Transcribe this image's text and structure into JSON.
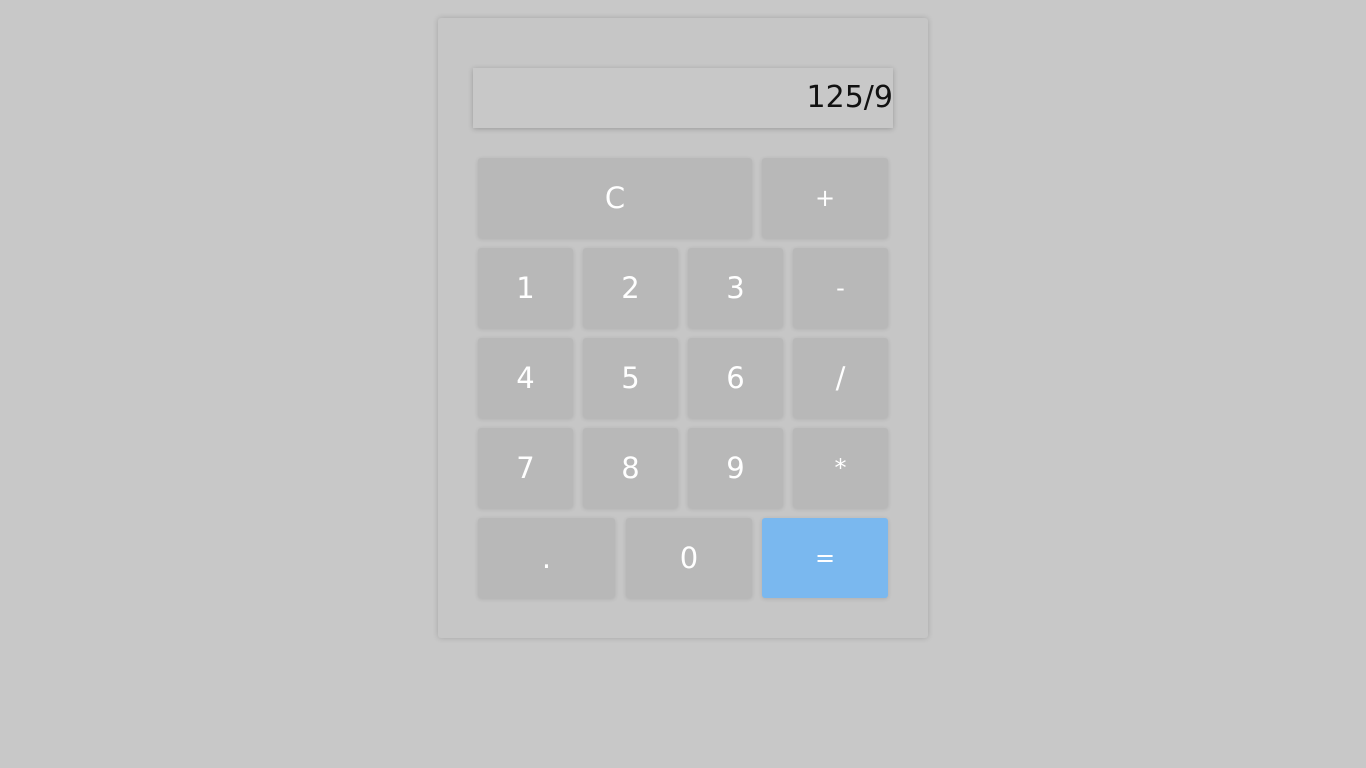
{
  "display": {
    "value": "125/9"
  },
  "keys": {
    "clear": "C",
    "plus": "+",
    "one": "1",
    "two": "2",
    "three": "3",
    "minus": "-",
    "four": "4",
    "five": "5",
    "six": "6",
    "divide": "/",
    "seven": "7",
    "eight": "8",
    "nine": "9",
    "multiply": "*",
    "decimal": ".",
    "zero": "0",
    "equals": "="
  },
  "colors": {
    "background": "#c8c8c8",
    "key": "#b8b8b8",
    "equals_accent": "#7ab8ef"
  }
}
